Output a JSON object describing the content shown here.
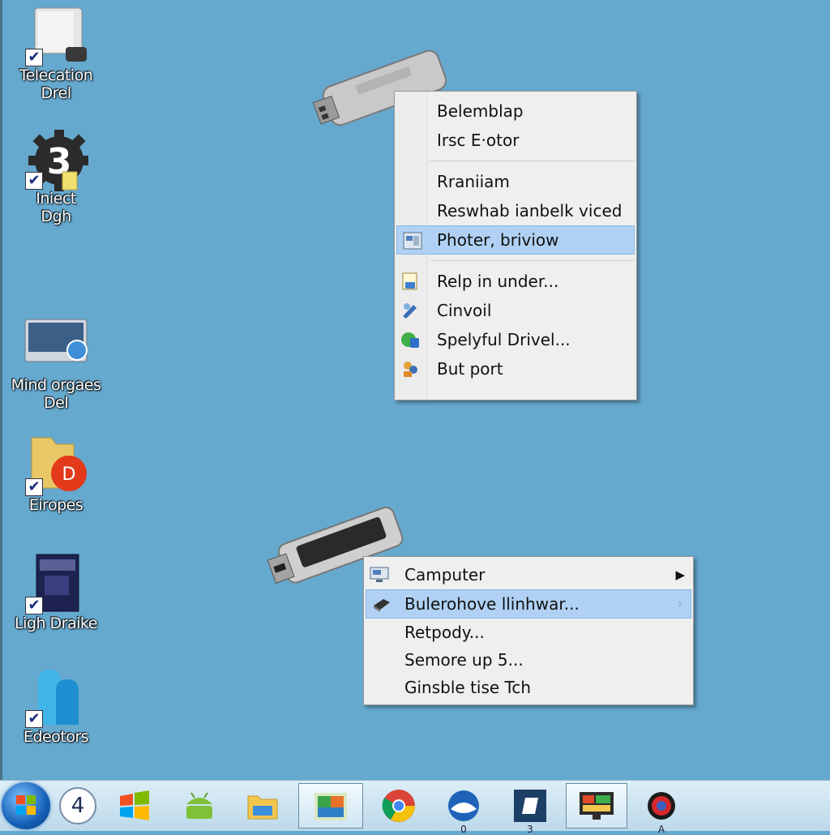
{
  "desktop": {
    "icons": [
      {
        "label": "Telecation\nDrel",
        "checked": true,
        "icon": "drive-icon"
      },
      {
        "label": "Iniect\nDgh",
        "checked": true,
        "icon": "gear-icon"
      },
      {
        "label": "Mind orgaes\nDel",
        "checked": false,
        "icon": "monitor-icon"
      },
      {
        "label": "Eiropes",
        "checked": true,
        "icon": "folder-icon"
      },
      {
        "label": "Ligh Draike",
        "checked": true,
        "icon": "book-icon"
      },
      {
        "label": "Edeotors",
        "checked": true,
        "icon": "shapes-icon"
      }
    ]
  },
  "menu_top": {
    "group1": [
      "Belemblap",
      "Irsc E·otor"
    ],
    "group2": [
      "Rraniiam",
      "Reswhab ianbelk viced",
      "Photer, briviow"
    ],
    "highlighted_index": 2,
    "group3": [
      "Relp in under...",
      "Cinvoil",
      "Spelyful Drivel...",
      "But port"
    ]
  },
  "menu_bottom": {
    "items": [
      {
        "label": "Camputer",
        "arrow": "▶"
      },
      {
        "label": "Bulerohove llinhwar...",
        "arrow": "›"
      },
      {
        "label": "Retpody...",
        "arrow": ""
      },
      {
        "label": "Semore up 5...",
        "arrow": ""
      },
      {
        "label": "Ginsble tise Tch",
        "arrow": ""
      }
    ]
  },
  "taskbar": {
    "badge_4": "4",
    "items": [
      {
        "name": "ie-app",
        "badge": ""
      },
      {
        "name": "windows-flag-app",
        "badge": ""
      },
      {
        "name": "android-app",
        "badge": ""
      },
      {
        "name": "file-explorer-app",
        "badge": ""
      },
      {
        "name": "media-app",
        "badge": ""
      },
      {
        "name": "chrome-app",
        "badge": ""
      },
      {
        "name": "globe-app",
        "badge": "0"
      },
      {
        "name": "editor-app",
        "badge": "3"
      },
      {
        "name": "control-panel-app",
        "badge": ""
      },
      {
        "name": "red-orb-app",
        "badge": "A"
      }
    ]
  },
  "colors": {
    "desktop": "#66a9cf",
    "highlight": "#b0d1f3"
  }
}
